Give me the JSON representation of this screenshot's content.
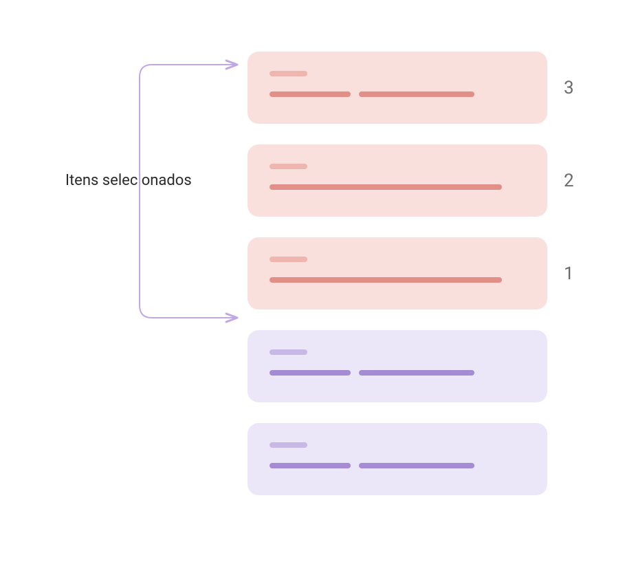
{
  "label": "Itens selecionados",
  "cards": [
    {
      "selected": true,
      "rank": "3",
      "bar_widths": {
        "short": 55,
        "segments": [
          118,
          168
        ]
      }
    },
    {
      "selected": true,
      "rank": "2",
      "bar_widths": {
        "short": 55,
        "segments": [
          338
        ]
      }
    },
    {
      "selected": true,
      "rank": "1",
      "bar_widths": {
        "short": 55,
        "segments": [
          338
        ]
      }
    },
    {
      "selected": false,
      "rank": "",
      "bar_widths": {
        "short": 55,
        "segments": [
          118,
          168
        ]
      }
    },
    {
      "selected": false,
      "rank": "",
      "bar_widths": {
        "short": 55,
        "segments": [
          118,
          168
        ]
      }
    }
  ],
  "colors": {
    "selected_bg": "#f9e0dd",
    "selected_light_bar": "#eeb6af",
    "selected_dark_bar": "#e28f88",
    "unselected_bg": "#ece7f8",
    "unselected_light_bar": "#c7b8e6",
    "unselected_dark_bar": "#a58ad4",
    "arrow": "#c0a8e8",
    "rank_text": "#6b6b6b",
    "label_text": "#2a2a2a"
  }
}
